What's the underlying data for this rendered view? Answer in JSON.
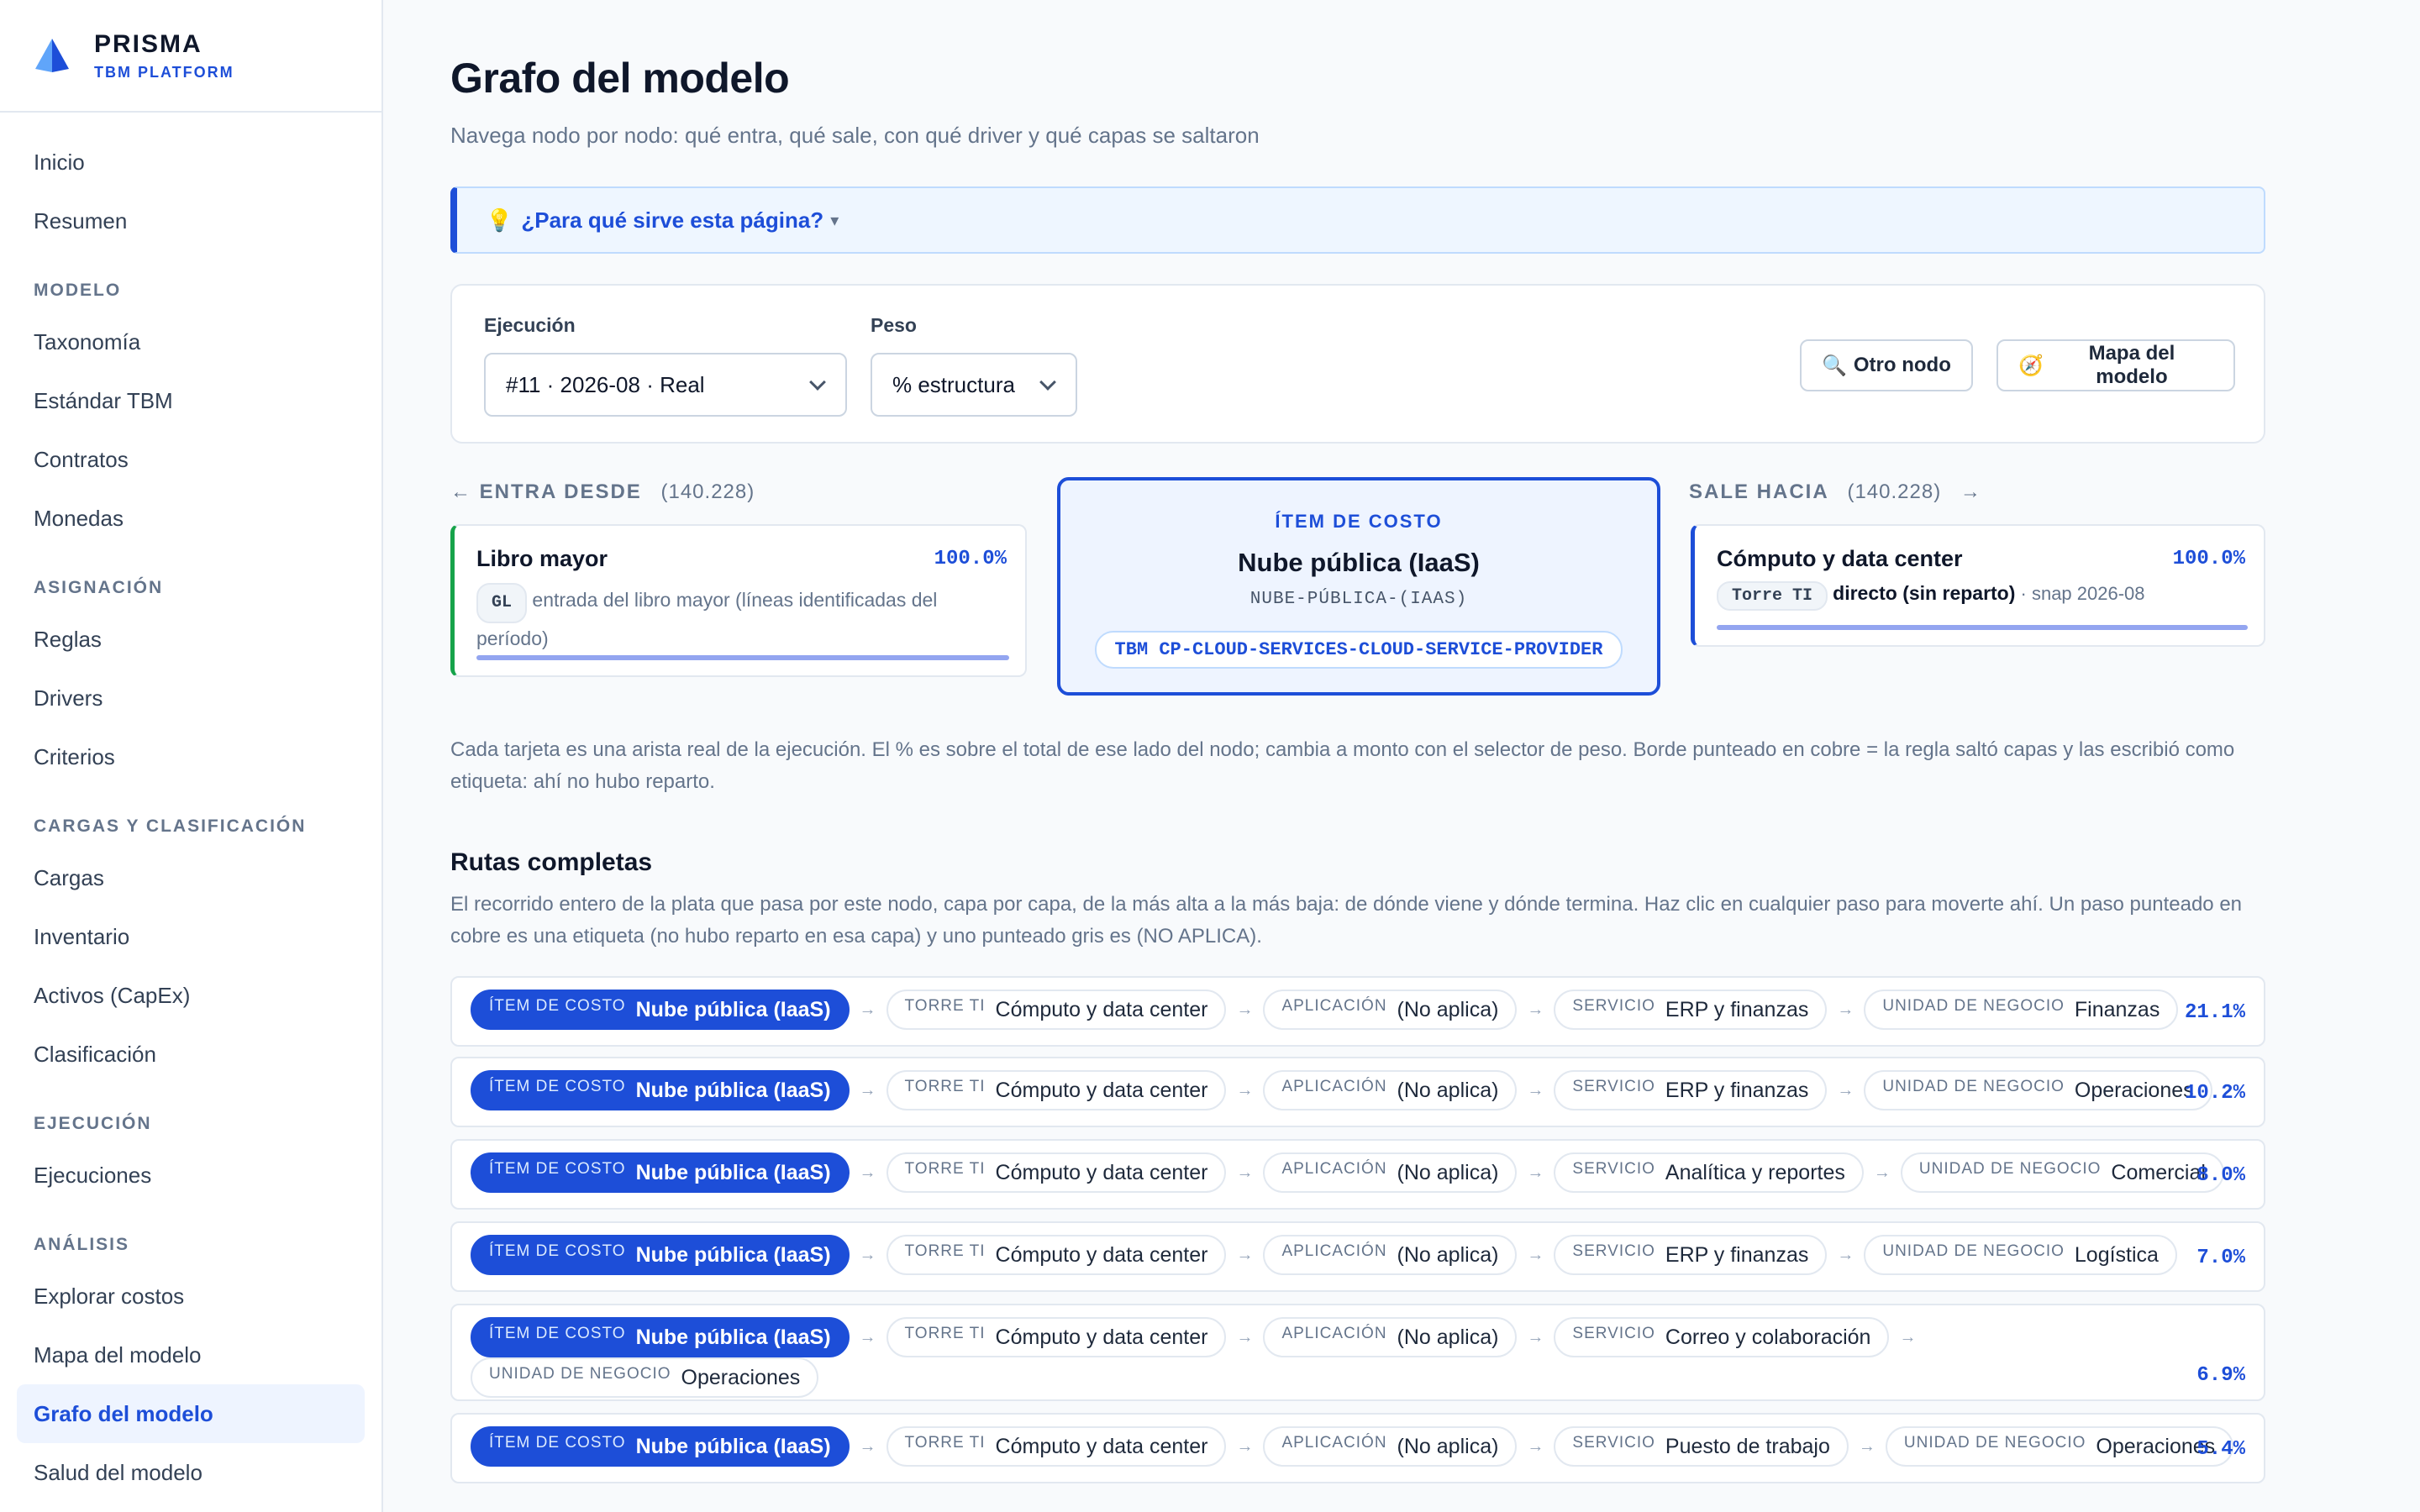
{
  "brand": {
    "name": "PRISMA",
    "subtitle": "TBM PLATFORM"
  },
  "nav": {
    "inicio": "Inicio",
    "resumen": "Resumen",
    "sec_modelo": "MODELO",
    "taxonomia": "Taxonomía",
    "estandar": "Estándar TBM",
    "contratos": "Contratos",
    "monedas": "Monedas",
    "sec_asignacion": "ASIGNACIÓN",
    "reglas": "Reglas",
    "drivers": "Drivers",
    "criterios": "Criterios",
    "sec_cargas": "CARGAS Y CLASIFICACIÓN",
    "cargas": "Cargas",
    "inventario": "Inventario",
    "activos": "Activos (CapEx)",
    "clasificacion": "Clasificación",
    "sec_ejecucion": "EJECUCIÓN",
    "ejecuciones": "Ejecuciones",
    "sec_analisis": "ANÁLISIS",
    "explorar": "Explorar costos",
    "mapa": "Mapa del modelo",
    "grafo": "Grafo del modelo",
    "salud": "Salud del modelo"
  },
  "page": {
    "title": "Grafo del modelo",
    "subtitle": "Navega nodo por nodo: qué entra, qué sale, con qué driver y qué capas se saltaron",
    "help": "¿Para qué sirve esta página?",
    "help_icon": "💡",
    "help_caret": "▾"
  },
  "filters": {
    "ejecucion_label": "Ejecución",
    "ejecucion_value": "#11 · 2026-08 · Real",
    "peso_label": "Peso",
    "peso_value": "% estructura",
    "otro_nodo": "Otro nodo",
    "otro_nodo_icon": "🔍",
    "mapa": "Mapa del modelo",
    "mapa_icon": "🧭"
  },
  "incoming": {
    "arrow": "←",
    "head": "ENTRA DESDE",
    "count": "(140.228)",
    "name": "Libro mayor",
    "pct": "100.0%",
    "tag": "GL",
    "desc": "entrada del libro mayor (líneas identificadas del período)",
    "bar_fraction": 1.0
  },
  "node": {
    "kind": "ÍTEM DE COSTO",
    "title": "Nube pública (IaaS)",
    "code": "NUBE-PÚBLICA-(IAAS)",
    "tbm": "TBM CP-CLOUD-SERVICES-CLOUD-SERVICE-PROVIDER"
  },
  "outgoing": {
    "arrow": "→",
    "head": "SALE HACIA",
    "count": "(140.228)",
    "name": "Cómputo y data center",
    "pct": "100.0%",
    "tag": "Torre TI",
    "desc_bold": "directo (sin reparto)",
    "desc_tail": " · snap 2026-08",
    "bar_fraction": 1.0
  },
  "note": "Cada tarjeta es una arista real de la ejecución. El % es sobre el total de ese lado del nodo; cambia a monto con el selector de peso. Borde punteado en cobre = la regla saltó capas y las escribió como etiqueta: ahí no hubo reparto.",
  "rutas": {
    "title": "Rutas completas",
    "desc": "El recorrido entero de la plata que pasa por este nodo, capa por capa, de la más alta a la más baja: de dónde viene y dónde termina. Haz clic en cualquier paso para moverte ahí. Un paso punteado en cobre es una etiqueta (no hubo reparto en esa capa) y uno punteado gris es (NO APLICA).",
    "arrow": "→",
    "routes": [
      {
        "pct": "21.1%",
        "steps": [
          {
            "label": "ÍTEM DE COSTO",
            "value": "Nube pública (IaaS)"
          },
          {
            "label": "TORRE TI",
            "value": "Cómputo y data center"
          },
          {
            "label": "APLICACIÓN",
            "value": "(No aplica)"
          },
          {
            "label": "SERVICIO",
            "value": "ERP y finanzas"
          },
          {
            "label": "UNIDAD DE NEGOCIO",
            "value": "Finanzas"
          }
        ]
      },
      {
        "pct": "10.2%",
        "steps": [
          {
            "label": "ÍTEM DE COSTO",
            "value": "Nube pública (IaaS)"
          },
          {
            "label": "TORRE TI",
            "value": "Cómputo y data center"
          },
          {
            "label": "APLICACIÓN",
            "value": "(No aplica)"
          },
          {
            "label": "SERVICIO",
            "value": "ERP y finanzas"
          },
          {
            "label": "UNIDAD DE NEGOCIO",
            "value": "Operaciones"
          }
        ]
      },
      {
        "pct": "8.0%",
        "steps": [
          {
            "label": "ÍTEM DE COSTO",
            "value": "Nube pública (IaaS)"
          },
          {
            "label": "TORRE TI",
            "value": "Cómputo y data center"
          },
          {
            "label": "APLICACIÓN",
            "value": "(No aplica)"
          },
          {
            "label": "SERVICIO",
            "value": "Analítica y reportes"
          },
          {
            "label": "UNIDAD DE NEGOCIO",
            "value": "Comercial"
          }
        ]
      },
      {
        "pct": "7.0%",
        "steps": [
          {
            "label": "ÍTEM DE COSTO",
            "value": "Nube pública (IaaS)"
          },
          {
            "label": "TORRE TI",
            "value": "Cómputo y data center"
          },
          {
            "label": "APLICACIÓN",
            "value": "(No aplica)"
          },
          {
            "label": "SERVICIO",
            "value": "ERP y finanzas"
          },
          {
            "label": "UNIDAD DE NEGOCIO",
            "value": "Logística"
          }
        ]
      },
      {
        "pct": "6.9%",
        "steps": [
          {
            "label": "ÍTEM DE COSTO",
            "value": "Nube pública (IaaS)"
          },
          {
            "label": "TORRE TI",
            "value": "Cómputo y data center"
          },
          {
            "label": "APLICACIÓN",
            "value": "(No aplica)"
          },
          {
            "label": "SERVICIO",
            "value": "Correo y colaboración"
          },
          {
            "label": "UNIDAD DE NEGOCIO",
            "value": "Operaciones"
          }
        ]
      },
      {
        "pct": "5.4%",
        "steps": [
          {
            "label": "ÍTEM DE COSTO",
            "value": "Nube pública (IaaS)"
          },
          {
            "label": "TORRE TI",
            "value": "Cómputo y data center"
          },
          {
            "label": "APLICACIÓN",
            "value": "(No aplica)"
          },
          {
            "label": "SERVICIO",
            "value": "Puesto de trabajo"
          },
          {
            "label": "UNIDAD DE NEGOCIO",
            "value": "Operaciones"
          }
        ]
      }
    ]
  },
  "colors": {
    "accent": "#1d4ed8",
    "green_edge": "#16a34a",
    "bar": "#93a5f0"
  }
}
